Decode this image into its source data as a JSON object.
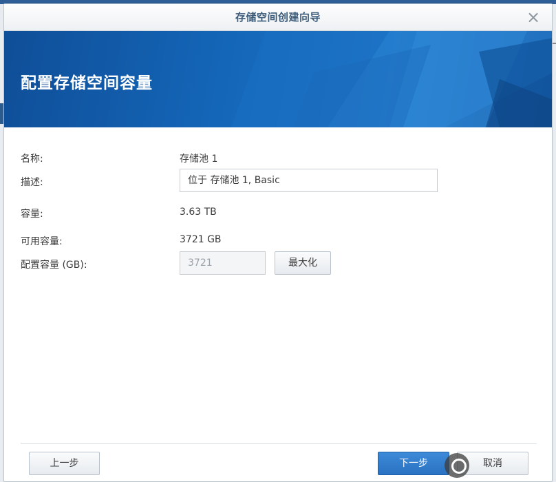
{
  "dialog": {
    "title": "存储空间创建向导",
    "close_icon": "close-icon"
  },
  "banner": {
    "heading": "配置存储空间容量"
  },
  "form": {
    "name_label": "名称:",
    "name_value": "存储池 1",
    "description_label": "描述:",
    "description_value": "位于 存储池 1, Basic",
    "capacity_label": "容量:",
    "capacity_value": "3.63 TB",
    "available_label": "可用容量:",
    "available_value": "3721 GB",
    "allocated_label": "配置容量 (GB):",
    "allocated_value": "3721",
    "maximize_button": "最大化"
  },
  "footer": {
    "back_button": "上一步",
    "next_button": "下一步",
    "cancel_button": "取消"
  },
  "colors": {
    "banner": "#1466b8",
    "primary_button": "#2a72c2"
  }
}
